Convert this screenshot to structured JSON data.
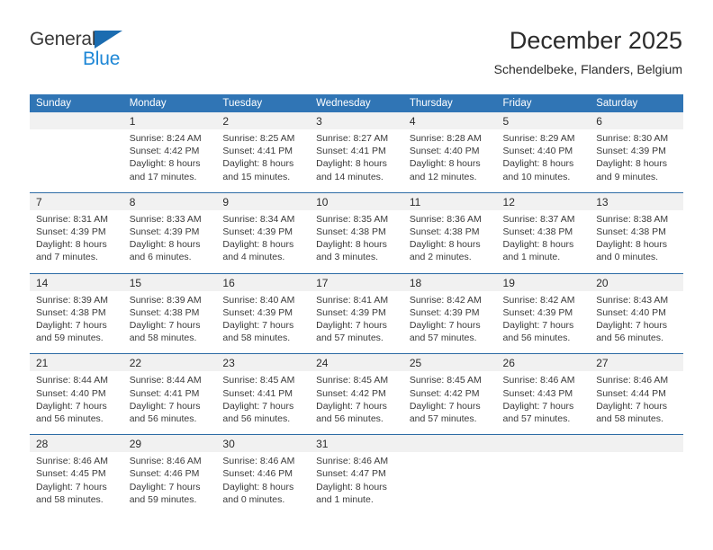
{
  "logo": {
    "word_general": "General",
    "word_blue": "Blue",
    "triangle_color": "#1b6cb0",
    "blue_color": "#1e87d6"
  },
  "header": {
    "title": "December 2025",
    "subtitle": "Schendelbeke, Flanders, Belgium"
  },
  "theme": {
    "header_blue": "#3075b5",
    "row_divider_blue": "#2d6ca5",
    "daynum_band": "#f1f1f1",
    "text": "#3a3a3a"
  },
  "calendar": {
    "weekday_headers": [
      "Sunday",
      "Monday",
      "Tuesday",
      "Wednesday",
      "Thursday",
      "Friday",
      "Saturday"
    ],
    "weeks": [
      [
        {
          "day": "",
          "lines": []
        },
        {
          "day": "1",
          "lines": [
            "Sunrise: 8:24 AM",
            "Sunset: 4:42 PM",
            "Daylight: 8 hours",
            "and 17 minutes."
          ]
        },
        {
          "day": "2",
          "lines": [
            "Sunrise: 8:25 AM",
            "Sunset: 4:41 PM",
            "Daylight: 8 hours",
            "and 15 minutes."
          ]
        },
        {
          "day": "3",
          "lines": [
            "Sunrise: 8:27 AM",
            "Sunset: 4:41 PM",
            "Daylight: 8 hours",
            "and 14 minutes."
          ]
        },
        {
          "day": "4",
          "lines": [
            "Sunrise: 8:28 AM",
            "Sunset: 4:40 PM",
            "Daylight: 8 hours",
            "and 12 minutes."
          ]
        },
        {
          "day": "5",
          "lines": [
            "Sunrise: 8:29 AM",
            "Sunset: 4:40 PM",
            "Daylight: 8 hours",
            "and 10 minutes."
          ]
        },
        {
          "day": "6",
          "lines": [
            "Sunrise: 8:30 AM",
            "Sunset: 4:39 PM",
            "Daylight: 8 hours",
            "and 9 minutes."
          ]
        }
      ],
      [
        {
          "day": "7",
          "lines": [
            "Sunrise: 8:31 AM",
            "Sunset: 4:39 PM",
            "Daylight: 8 hours",
            "and 7 minutes."
          ]
        },
        {
          "day": "8",
          "lines": [
            "Sunrise: 8:33 AM",
            "Sunset: 4:39 PM",
            "Daylight: 8 hours",
            "and 6 minutes."
          ]
        },
        {
          "day": "9",
          "lines": [
            "Sunrise: 8:34 AM",
            "Sunset: 4:39 PM",
            "Daylight: 8 hours",
            "and 4 minutes."
          ]
        },
        {
          "day": "10",
          "lines": [
            "Sunrise: 8:35 AM",
            "Sunset: 4:38 PM",
            "Daylight: 8 hours",
            "and 3 minutes."
          ]
        },
        {
          "day": "11",
          "lines": [
            "Sunrise: 8:36 AM",
            "Sunset: 4:38 PM",
            "Daylight: 8 hours",
            "and 2 minutes."
          ]
        },
        {
          "day": "12",
          "lines": [
            "Sunrise: 8:37 AM",
            "Sunset: 4:38 PM",
            "Daylight: 8 hours",
            "and 1 minute."
          ]
        },
        {
          "day": "13",
          "lines": [
            "Sunrise: 8:38 AM",
            "Sunset: 4:38 PM",
            "Daylight: 8 hours",
            "and 0 minutes."
          ]
        }
      ],
      [
        {
          "day": "14",
          "lines": [
            "Sunrise: 8:39 AM",
            "Sunset: 4:38 PM",
            "Daylight: 7 hours",
            "and 59 minutes."
          ]
        },
        {
          "day": "15",
          "lines": [
            "Sunrise: 8:39 AM",
            "Sunset: 4:38 PM",
            "Daylight: 7 hours",
            "and 58 minutes."
          ]
        },
        {
          "day": "16",
          "lines": [
            "Sunrise: 8:40 AM",
            "Sunset: 4:39 PM",
            "Daylight: 7 hours",
            "and 58 minutes."
          ]
        },
        {
          "day": "17",
          "lines": [
            "Sunrise: 8:41 AM",
            "Sunset: 4:39 PM",
            "Daylight: 7 hours",
            "and 57 minutes."
          ]
        },
        {
          "day": "18",
          "lines": [
            "Sunrise: 8:42 AM",
            "Sunset: 4:39 PM",
            "Daylight: 7 hours",
            "and 57 minutes."
          ]
        },
        {
          "day": "19",
          "lines": [
            "Sunrise: 8:42 AM",
            "Sunset: 4:39 PM",
            "Daylight: 7 hours",
            "and 56 minutes."
          ]
        },
        {
          "day": "20",
          "lines": [
            "Sunrise: 8:43 AM",
            "Sunset: 4:40 PM",
            "Daylight: 7 hours",
            "and 56 minutes."
          ]
        }
      ],
      [
        {
          "day": "21",
          "lines": [
            "Sunrise: 8:44 AM",
            "Sunset: 4:40 PM",
            "Daylight: 7 hours",
            "and 56 minutes."
          ]
        },
        {
          "day": "22",
          "lines": [
            "Sunrise: 8:44 AM",
            "Sunset: 4:41 PM",
            "Daylight: 7 hours",
            "and 56 minutes."
          ]
        },
        {
          "day": "23",
          "lines": [
            "Sunrise: 8:45 AM",
            "Sunset: 4:41 PM",
            "Daylight: 7 hours",
            "and 56 minutes."
          ]
        },
        {
          "day": "24",
          "lines": [
            "Sunrise: 8:45 AM",
            "Sunset: 4:42 PM",
            "Daylight: 7 hours",
            "and 56 minutes."
          ]
        },
        {
          "day": "25",
          "lines": [
            "Sunrise: 8:45 AM",
            "Sunset: 4:42 PM",
            "Daylight: 7 hours",
            "and 57 minutes."
          ]
        },
        {
          "day": "26",
          "lines": [
            "Sunrise: 8:46 AM",
            "Sunset: 4:43 PM",
            "Daylight: 7 hours",
            "and 57 minutes."
          ]
        },
        {
          "day": "27",
          "lines": [
            "Sunrise: 8:46 AM",
            "Sunset: 4:44 PM",
            "Daylight: 7 hours",
            "and 58 minutes."
          ]
        }
      ],
      [
        {
          "day": "28",
          "lines": [
            "Sunrise: 8:46 AM",
            "Sunset: 4:45 PM",
            "Daylight: 7 hours",
            "and 58 minutes."
          ]
        },
        {
          "day": "29",
          "lines": [
            "Sunrise: 8:46 AM",
            "Sunset: 4:46 PM",
            "Daylight: 7 hours",
            "and 59 minutes."
          ]
        },
        {
          "day": "30",
          "lines": [
            "Sunrise: 8:46 AM",
            "Sunset: 4:46 PM",
            "Daylight: 8 hours",
            "and 0 minutes."
          ]
        },
        {
          "day": "31",
          "lines": [
            "Sunrise: 8:46 AM",
            "Sunset: 4:47 PM",
            "Daylight: 8 hours",
            "and 1 minute."
          ]
        },
        {
          "day": "",
          "lines": []
        },
        {
          "day": "",
          "lines": []
        },
        {
          "day": "",
          "lines": []
        }
      ]
    ]
  }
}
